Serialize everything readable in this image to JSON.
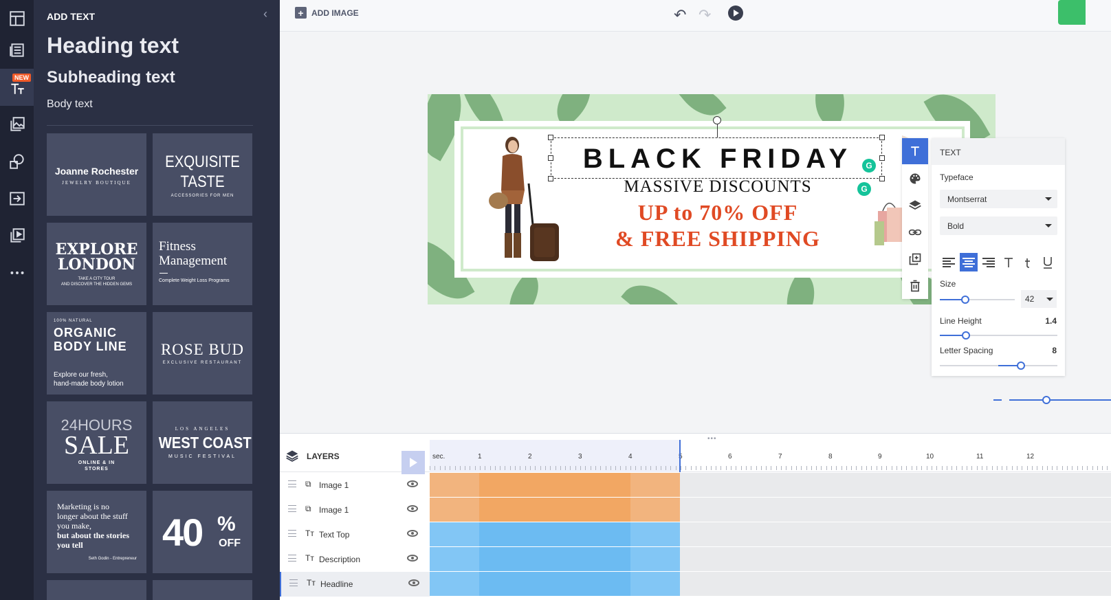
{
  "rail": {
    "new_badge": "NEW",
    "items": [
      "layout-icon",
      "list-icon",
      "text-icon",
      "image-icon",
      "shapes-icon",
      "import-icon",
      "video-icon",
      "more-icon"
    ]
  },
  "panel": {
    "title": "ADD TEXT",
    "heading": "Heading text",
    "subheading": "Subheading text",
    "body": "Body text",
    "tiles": {
      "t1": {
        "main": "Joanne Rochester",
        "sub": "JEWELRY BOUTIQUE"
      },
      "t2": {
        "l1": "EXQUISITE",
        "l2": "TASTE",
        "sub": "ACCESSORIES FOR MEN"
      },
      "t3": {
        "l1": "EXPLORE",
        "l2": "LONDON",
        "sub1": "TAKE A CITY TOUR",
        "sub2": "AND DISCOVER THE HIDDEN GEMS"
      },
      "t4": {
        "l1": "Fitness",
        "l2": "Management",
        "sub": "Complete Weight Loss Programs"
      },
      "t5": {
        "top": "100% NATURAL",
        "l1": "ORGANIC",
        "l2": "BODY LINE",
        "sub1": "Explore our fresh,",
        "sub2": "hand-made body lotion"
      },
      "t6": {
        "main": "ROSE BUD",
        "sub": "EXCLUSIVE RESTAURANT"
      },
      "t7": {
        "l1": "24HOURS",
        "l2": "SALE",
        "sub1": "ONLINE & IN",
        "sub2": "STORES"
      },
      "t8": {
        "top": "LOS ANGELES",
        "main": "WEST COAST",
        "sub": "MUSIC FESTIVAL"
      },
      "t9": {
        "l1": "Marketing is no",
        "l2": "longer about the stuff",
        "l3": "you make,",
        "l4": "but about the stories",
        "l5": "you tell",
        "sub": "Seth Godin - Entrepreneur"
      },
      "t10": {
        "num": "40",
        "pct": "%",
        "off": "OFF"
      }
    }
  },
  "toolbar": {
    "add_image": "ADD IMAGE"
  },
  "design": {
    "headline": "BLACK FRIDAY",
    "description": "MASSIVE DISCOUNTS",
    "offer_line1": "UP to 70% OFF",
    "offer_line2": "& FREE SHIPPING"
  },
  "props": {
    "header": "TEXT",
    "typeface_label": "Typeface",
    "typeface_value": "Montserrat",
    "weight_value": "Bold",
    "size_label": "Size",
    "size_value": "42",
    "line_height_label": "Line Height",
    "line_height_value": "1.4",
    "letter_spacing_label": "Letter Spacing",
    "letter_spacing_value": "8"
  },
  "timeline": {
    "layers_label": "LAYERS",
    "ruler_unit": "sec.",
    "ruler_ticks": [
      "1",
      "2",
      "3",
      "4",
      "5",
      "6",
      "7",
      "8",
      "9",
      "10",
      "11",
      "12"
    ],
    "layers": [
      {
        "name": "Image 1",
        "icon": "image-layer-icon"
      },
      {
        "name": "Image 1",
        "icon": "image-layer-icon"
      },
      {
        "name": "Text Top",
        "icon": "text-layer-icon"
      },
      {
        "name": "Description",
        "icon": "text-layer-icon"
      },
      {
        "name": "Headline",
        "icon": "text-layer-icon"
      }
    ]
  },
  "colors": {
    "accent": "#3f6fd8",
    "offer_red": "#e04a24",
    "image_track": "#f2ad72",
    "text_track": "#7cc4f4",
    "save_green": "#3cbf6a"
  }
}
